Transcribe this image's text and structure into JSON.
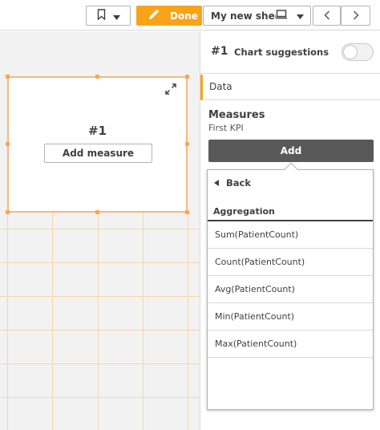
{
  "toolbar": {
    "bookmark_icon": "bookmark-icon",
    "done_label": "Done",
    "done_color": "#f8a31a",
    "sheet_name": "My new sheet",
    "sheet_icon": "monitor-icon"
  },
  "canvas": {
    "kpi_title": "#1",
    "add_measure_label": "Add measure",
    "selection_color": "#f5b87a"
  },
  "panel": {
    "object_number": "#1",
    "chart_suggestions_label": "Chart suggestions",
    "chart_suggestions_on": false,
    "data_tab": "Data",
    "measures_title": "Measures",
    "measure_name": "First KPI",
    "add_button": "Add",
    "dropdown": {
      "back_label": "Back",
      "aggregation_header": "Aggregation",
      "items": [
        "Sum(PatientCount)",
        "Count(PatientCount)",
        "Avg(PatientCount)",
        "Min(PatientCount)",
        "Max(PatientCount)"
      ]
    }
  }
}
